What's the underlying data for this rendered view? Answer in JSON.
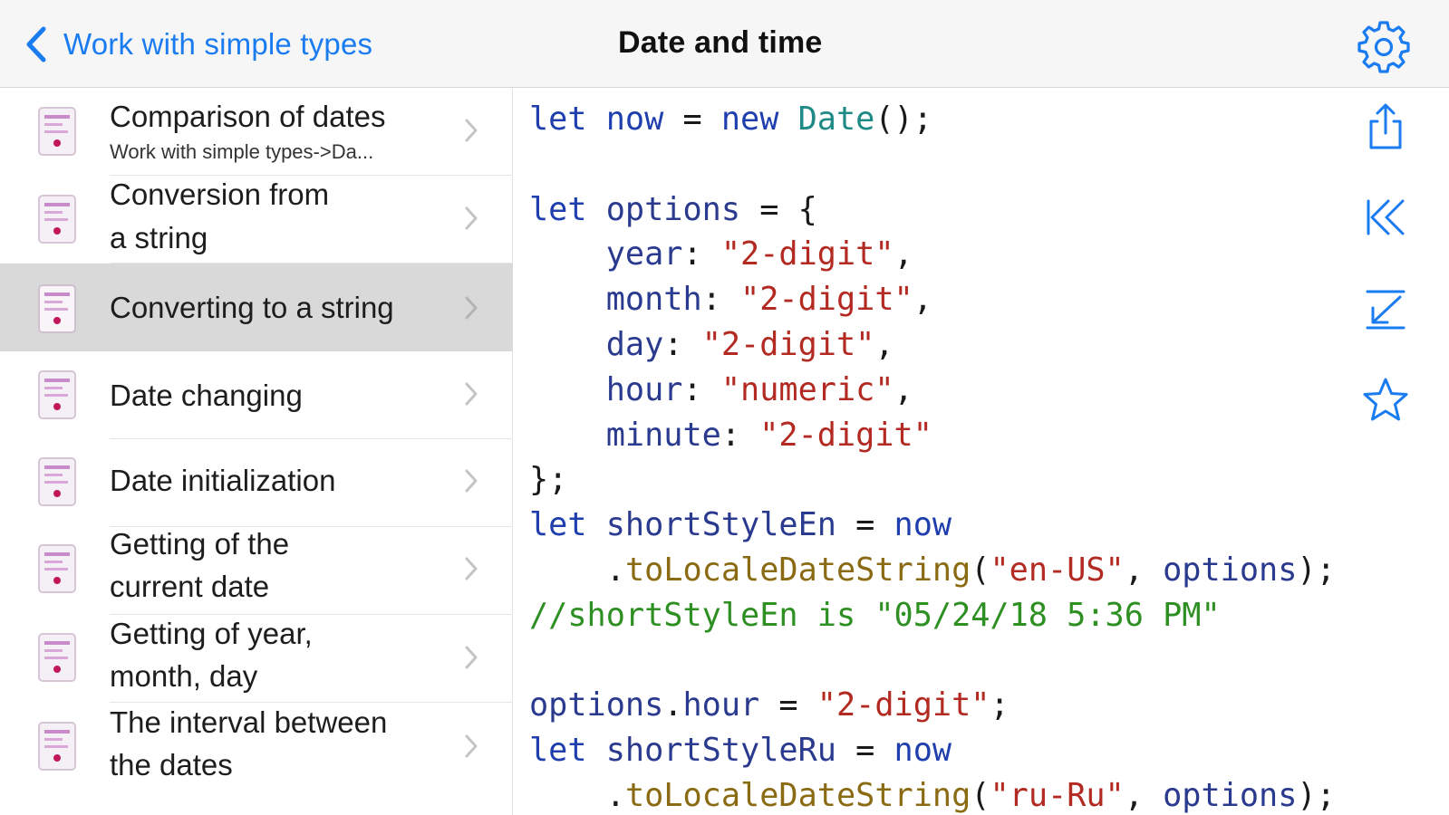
{
  "header": {
    "back_label": "Work with simple types",
    "title": "Date and time"
  },
  "icons": {
    "back": "chevron-left-icon",
    "settings": "gear-icon",
    "share": "share-icon",
    "first": "skip-to-start-icon",
    "last": "skip-to-end-icon",
    "favorite": "star-icon",
    "row_icon": "code-document-icon",
    "row_chevron": "chevron-right-icon"
  },
  "colors": {
    "accent": "#1a7cf0",
    "selected_row": "#d9d9d9",
    "keyword": "#1f3fae",
    "type": "#1e8a86",
    "string": "#b22a22",
    "method": "#8a6a12",
    "comment": "#2e8f22"
  },
  "sidebar": {
    "items": [
      {
        "line1": "Comparison of dates",
        "subtitle": "Work with simple types->Da..."
      },
      {
        "line1": "Conversion from",
        "line2": "a string"
      },
      {
        "line1": "Converting to a string"
      },
      {
        "line1": "Date changing"
      },
      {
        "line1": "Date initialization"
      },
      {
        "line1": "Getting of the",
        "line2": "current date"
      },
      {
        "line1": "Getting of year,",
        "line2": "month, day"
      },
      {
        "line1": "The interval between",
        "line2": "the dates"
      }
    ],
    "selected_index": 2
  },
  "code": {
    "language": "javascript",
    "lines": [
      "let now = new Date();",
      "",
      "let options = {",
      "    year: \"2-digit\",",
      "    month: \"2-digit\",",
      "    day: \"2-digit\",",
      "    hour: \"numeric\",",
      "    minute: \"2-digit\"",
      "};",
      "let shortStyleEn = now",
      "    .toLocaleDateString(\"en-US\", options);",
      "//shortStyleEn is \"05/24/18 5:36 PM\"",
      "",
      "options.hour = \"2-digit\";",
      "let shortStyleRu = now",
      "    .toLocaleDateString(\"ru-Ru\", options);"
    ]
  }
}
